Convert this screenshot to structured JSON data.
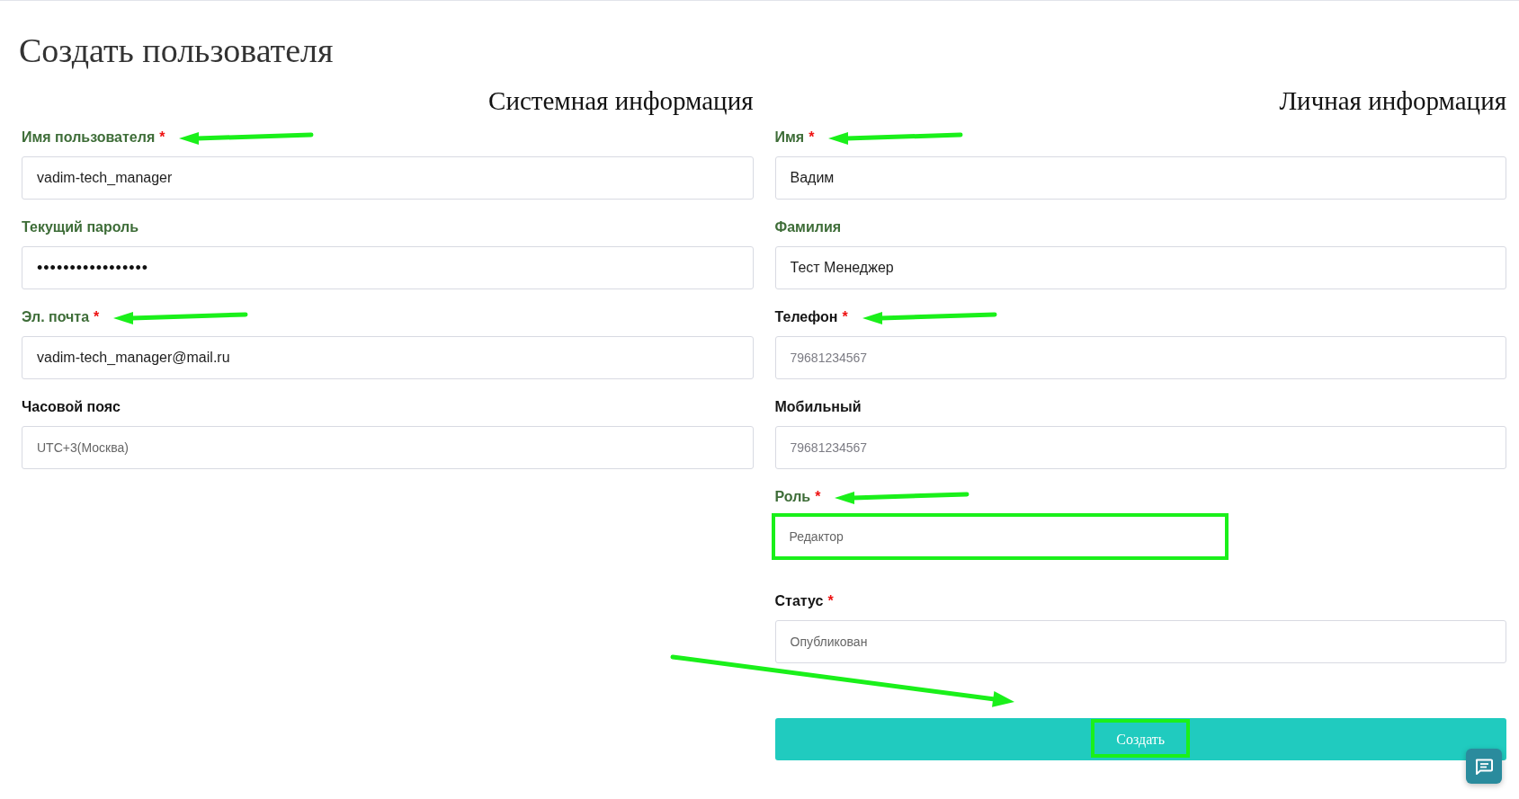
{
  "page": {
    "title": "Создать пользователя"
  },
  "sections": [
    {
      "title": "Системная информация",
      "fields": [
        {
          "label": "Имя пользователя",
          "required_mark": "*",
          "valid": true,
          "kind": "text",
          "value": "vadim-tech_manager",
          "arrow": true,
          "highlighted": false
        },
        {
          "label": "Текущий пароль",
          "valid": true,
          "kind": "password",
          "value": "•••••••••••••••••",
          "arrow": false,
          "highlighted": false
        },
        {
          "label": "Эл. почта",
          "required_mark": "*",
          "valid": true,
          "kind": "text",
          "value": "vadim-tech_manager@mail.ru",
          "arrow": true,
          "highlighted": false
        },
        {
          "label": "Часовой пояс",
          "valid": false,
          "kind": "select",
          "value": "UTC+3(Москва)",
          "arrow": false,
          "highlighted": false
        }
      ]
    },
    {
      "title": "Личная информация",
      "fields": [
        {
          "label": "Имя",
          "required_mark": "*",
          "valid": true,
          "kind": "text",
          "value": "Вадим",
          "arrow": true,
          "highlighted": false
        },
        {
          "label": "Фамилия",
          "valid": true,
          "kind": "text",
          "value": "Тест Менеджер",
          "arrow": false,
          "highlighted": false
        },
        {
          "label": "Телефон",
          "required_mark": "*",
          "valid": false,
          "kind": "text",
          "placeholder": "79681234567",
          "arrow": true,
          "highlighted": false
        },
        {
          "label": "Мобильный",
          "valid": false,
          "kind": "text",
          "placeholder": "79681234567",
          "arrow": false,
          "highlighted": false
        },
        {
          "label": "Роль",
          "required_mark": "*",
          "valid": true,
          "kind": "select",
          "value": "Редактор",
          "arrow": true,
          "highlighted": true
        },
        {
          "label": "Статус",
          "required_mark": "*",
          "valid": false,
          "kind": "select",
          "value": "Опубликован",
          "arrow": false,
          "highlighted": false
        }
      ],
      "submit": {
        "label": "Создать",
        "highlighted": true,
        "arrow": true
      }
    }
  ]
}
